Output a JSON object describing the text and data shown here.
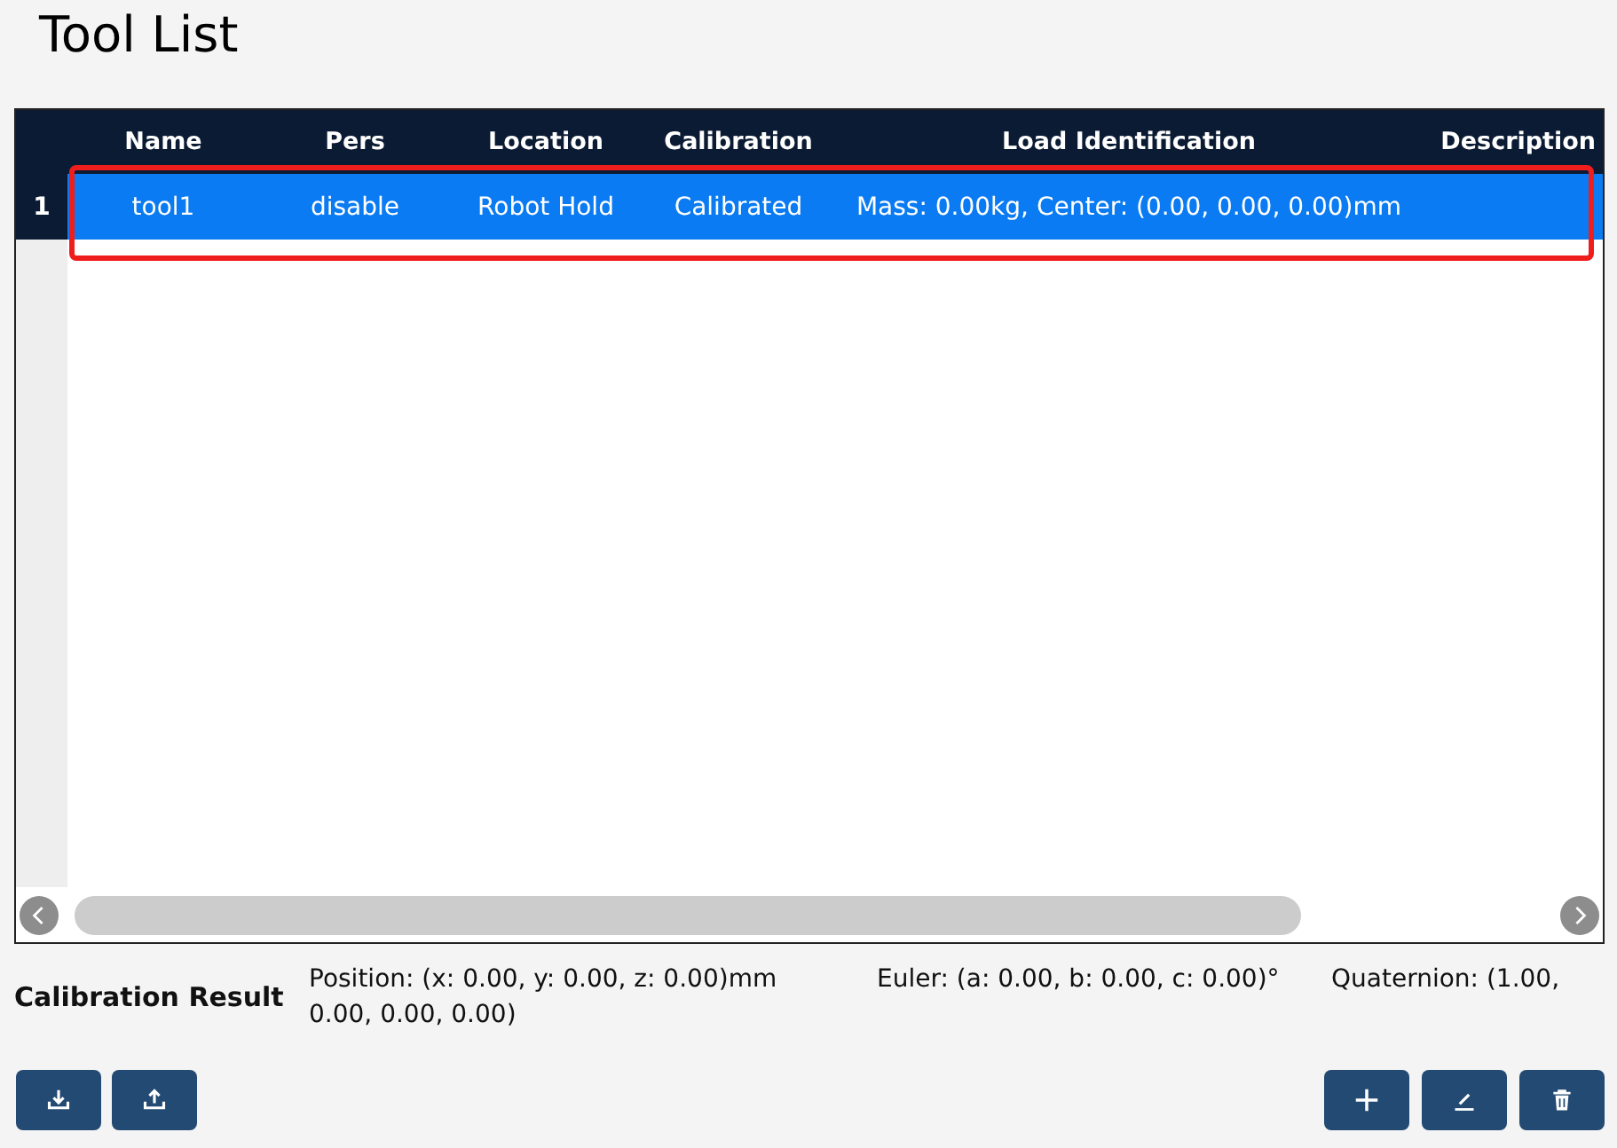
{
  "title": "Tool List",
  "table": {
    "columns": [
      "Name",
      "Pers",
      "Location",
      "Calibration",
      "Load Identification",
      "Description"
    ],
    "rows": [
      {
        "index": "1",
        "cells": [
          "tool1",
          "disable",
          "Robot Hold",
          "Calibrated",
          "Mass: 0.00kg, Center: (0.00, 0.00, 0.00)mm"
        ],
        "selected": true,
        "outlined": true
      }
    ]
  },
  "calibration_result": {
    "label": "Calibration Result",
    "position": "Position: (x: 0.00, y: 0.00, z: 0.00)mm",
    "euler": "Euler: (a: 0.00, b: 0.00, c: 0.00)°",
    "quaternion": "Quaternion: (1.00, 0.00, 0.00, 0.00)"
  },
  "left_buttons": [
    {
      "kind": "download"
    },
    {
      "kind": "upload"
    }
  ],
  "right_buttons": [
    {
      "kind": "add"
    },
    {
      "kind": "edit"
    },
    {
      "kind": "delete"
    }
  ]
}
